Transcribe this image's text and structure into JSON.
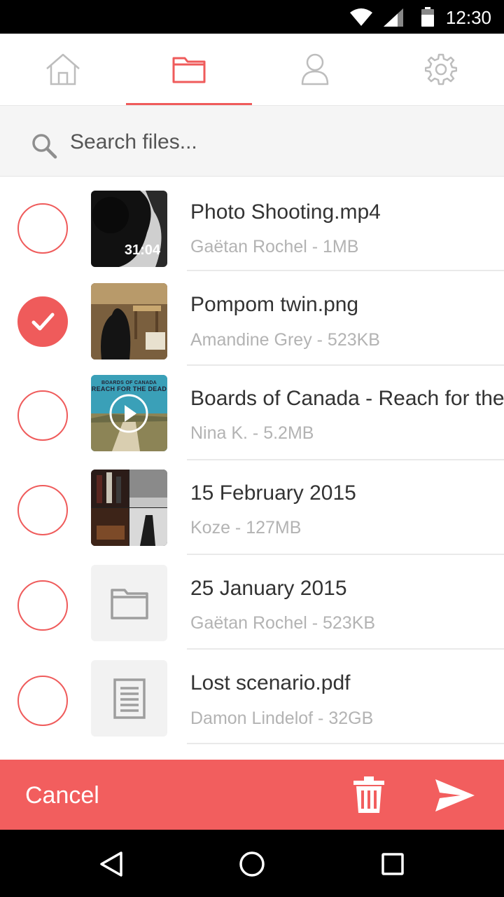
{
  "status_bar": {
    "time": "12:30"
  },
  "tabs": [
    {
      "icon": "home-icon",
      "selected": false
    },
    {
      "icon": "folder-icon",
      "selected": true
    },
    {
      "icon": "user-icon",
      "selected": false
    },
    {
      "icon": "gear-icon",
      "selected": false
    }
  ],
  "search": {
    "placeholder": "Search files..."
  },
  "files": [
    {
      "title": "Photo Shooting.mp4",
      "meta": "Gaëtan Rochel - 1MB",
      "checked": false,
      "thumb": "video",
      "duration": "31:04"
    },
    {
      "title": "Pompom twin.png",
      "meta": "Amandine Grey - 523KB",
      "checked": true,
      "thumb": "image"
    },
    {
      "title": "Boards of Canada - Reach for the Dead",
      "meta": "Nina K. - 5.2MB",
      "checked": false,
      "thumb": "album",
      "album_artist": "BOARDS OF CANADA",
      "album_title": "REACH FOR THE DEAD"
    },
    {
      "title": "15 February 2015",
      "meta": "Koze - 127MB",
      "checked": false,
      "thumb": "collage"
    },
    {
      "title": "25 January 2015",
      "meta": "Gaëtan Rochel - 523KB",
      "checked": false,
      "thumb": "folder"
    },
    {
      "title": "Lost scenario.pdf",
      "meta": "Damon Lindelof - 32GB",
      "checked": false,
      "thumb": "document"
    }
  ],
  "actions": {
    "cancel_label": "Cancel",
    "delete_icon": "trash-icon",
    "send_icon": "send-icon"
  },
  "colors": {
    "accent": "#ef5b5b",
    "action_bar": "#f25e5e",
    "tab_inactive": "#bdbdbd"
  }
}
